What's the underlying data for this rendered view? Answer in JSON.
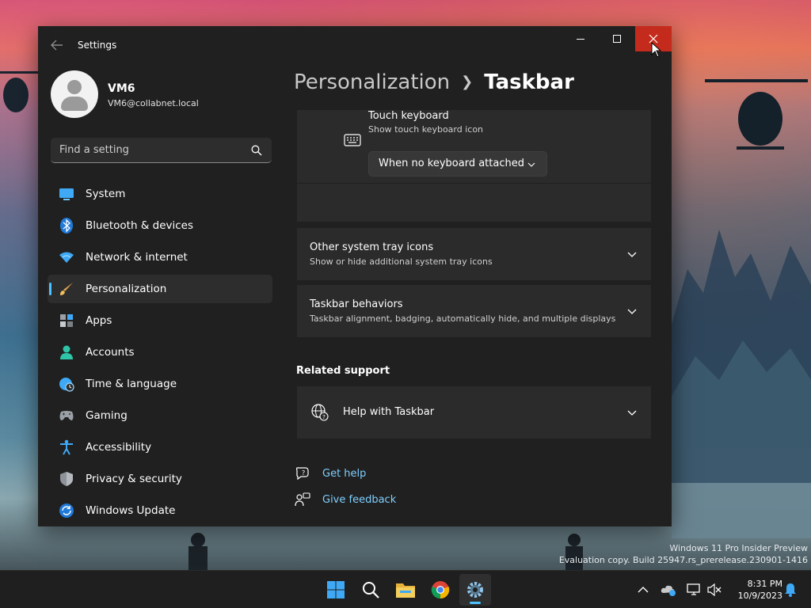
{
  "window": {
    "title": "Settings"
  },
  "profile": {
    "name": "VM6",
    "email": "VM6@collabnet.local"
  },
  "search": {
    "placeholder": "Find a setting"
  },
  "nav": [
    {
      "label": "System",
      "icon": "monitor-icon"
    },
    {
      "label": "Bluetooth & devices",
      "icon": "bluetooth-icon"
    },
    {
      "label": "Network & internet",
      "icon": "wifi-icon"
    },
    {
      "label": "Personalization",
      "icon": "brush-icon",
      "active": true
    },
    {
      "label": "Apps",
      "icon": "apps-icon"
    },
    {
      "label": "Accounts",
      "icon": "person-icon"
    },
    {
      "label": "Time & language",
      "icon": "globe-clock-icon"
    },
    {
      "label": "Gaming",
      "icon": "gamepad-icon"
    },
    {
      "label": "Accessibility",
      "icon": "accessibility-icon"
    },
    {
      "label": "Privacy & security",
      "icon": "shield-icon"
    },
    {
      "label": "Windows Update",
      "icon": "update-icon"
    }
  ],
  "header": {
    "parent": "Personalization",
    "current": "Taskbar"
  },
  "touch_keyboard": {
    "title": "Touch keyboard",
    "subtitle": "Show touch keyboard icon",
    "value": "When no keyboard attached"
  },
  "tray_icons": {
    "title": "Other system tray icons",
    "subtitle": "Show or hide additional system tray icons"
  },
  "behaviors": {
    "title": "Taskbar behaviors",
    "subtitle": "Taskbar alignment, badging, automatically hide, and multiple displays"
  },
  "related": {
    "title": "Related support",
    "help": "Help with Taskbar"
  },
  "links": {
    "get_help": "Get help",
    "give_feedback": "Give feedback"
  },
  "watermark": {
    "line1": "Windows 11 Pro Insider Preview",
    "line2": "Evaluation copy. Build 25947.rs_prerelease.230901-1416"
  },
  "clock": {
    "time": "8:31 PM",
    "date": "10/9/2023"
  },
  "colors": {
    "accent": "#4cc2ff",
    "close": "#c42b1c",
    "window_bg": "#202020",
    "card_bg": "#2b2b2b"
  }
}
